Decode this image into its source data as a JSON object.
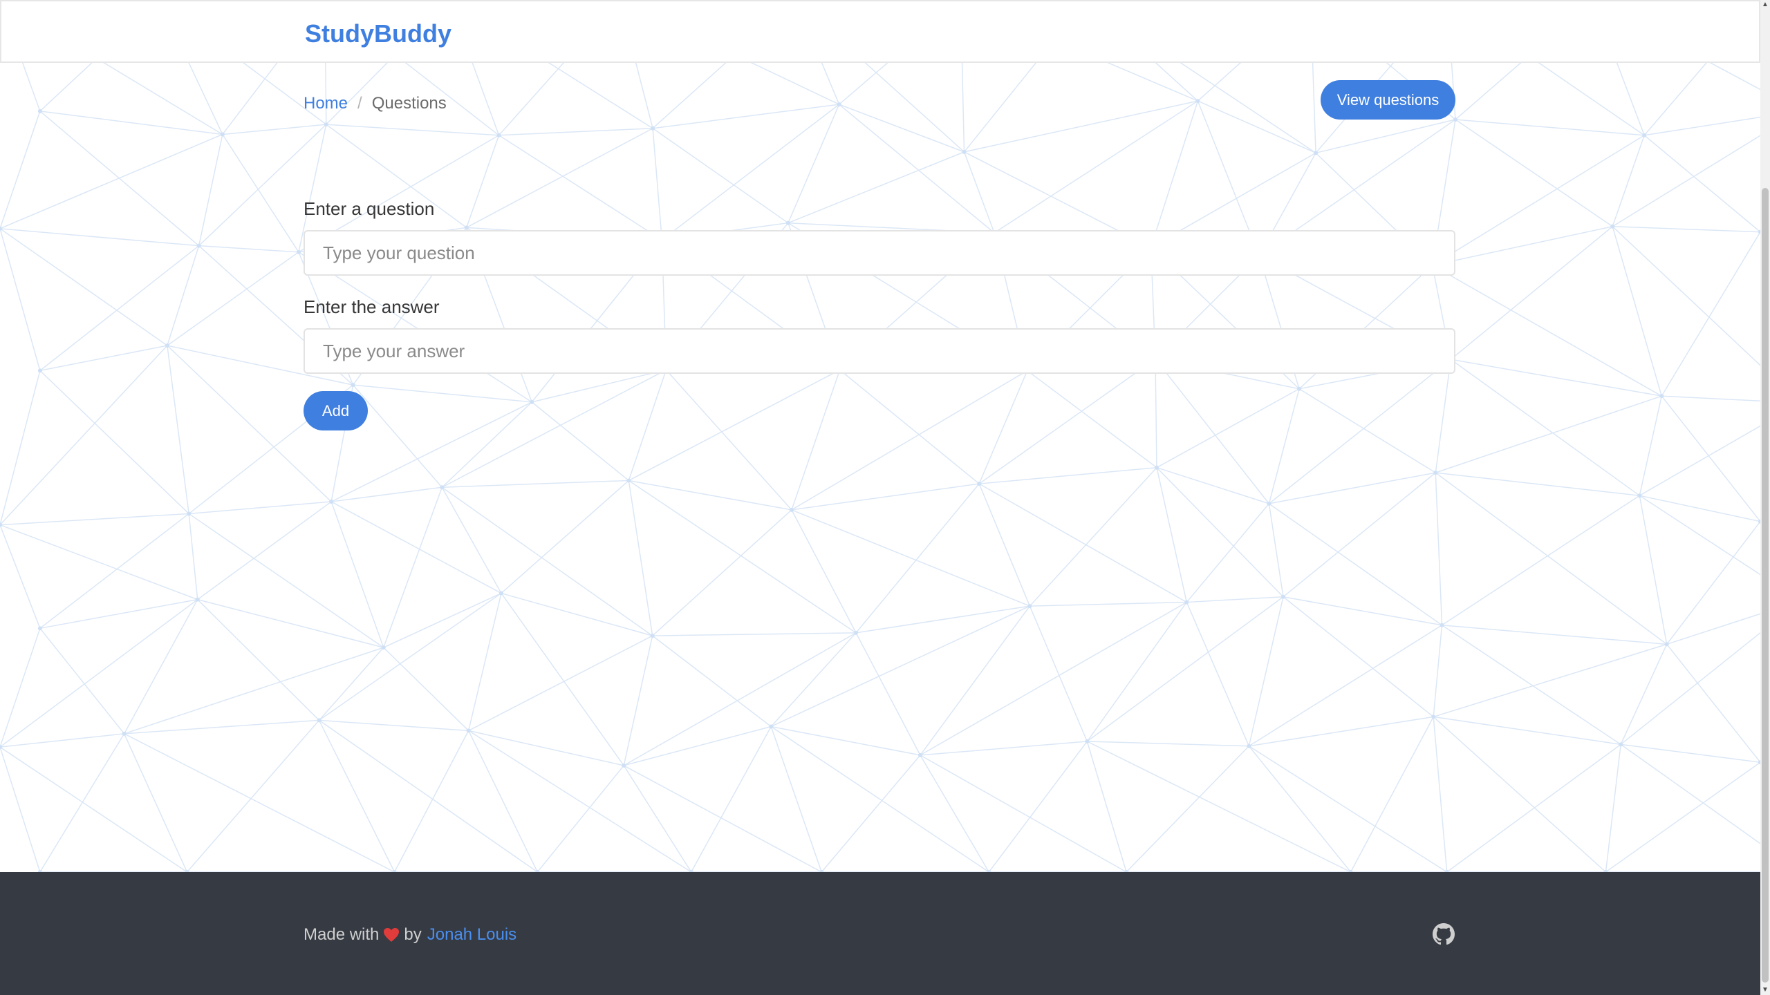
{
  "navbar": {
    "brand": "StudyBuddy"
  },
  "breadcrumb": {
    "home": "Home",
    "separator": "/",
    "current": "Questions"
  },
  "header": {
    "view_questions_label": "View questions"
  },
  "form": {
    "question_label": "Enter a question",
    "question_placeholder": "Type your question",
    "question_value": "",
    "answer_label": "Enter the answer",
    "answer_placeholder": "Type your answer",
    "answer_value": "",
    "add_label": "Add"
  },
  "footer": {
    "made_with": "Made with",
    "heart_icon": "heart-icon",
    "by": "by",
    "author": "Jonah Louis",
    "github_icon": "github-icon"
  },
  "colors": {
    "accent": "#3f7fe0",
    "footer_bg": "#363a42",
    "heart": "#e03c3c",
    "link": "#4a8fef"
  }
}
